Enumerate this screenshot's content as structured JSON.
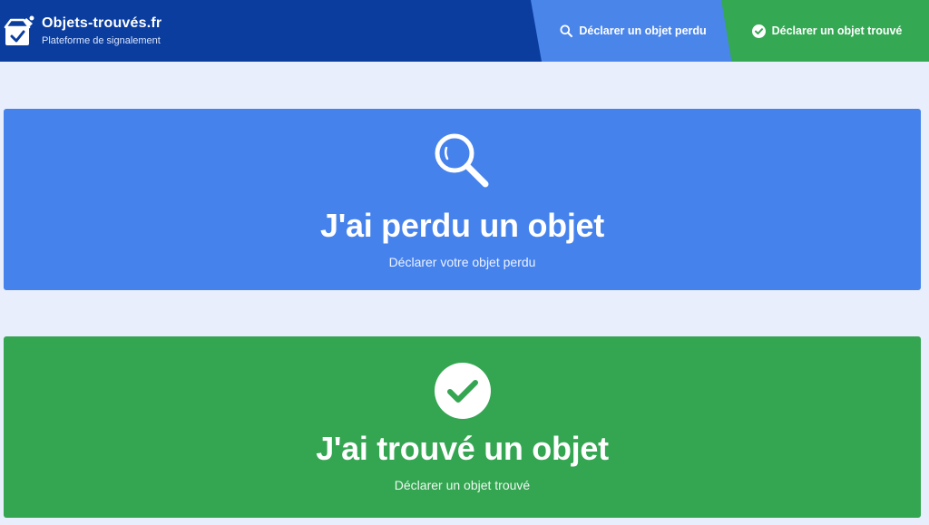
{
  "brand": {
    "title": "Objets-trouvés.fr",
    "subtitle": "Plateforme de signalement",
    "logo_icon": "box-check-icon"
  },
  "nav": {
    "lost_label": "Déclarer un objet perdu",
    "lost_icon": "search-icon",
    "found_label": "Déclarer un objet trouvé",
    "found_icon": "check-circle-icon"
  },
  "cards": {
    "lost": {
      "title": "J'ai perdu un objet",
      "subtitle": "Déclarer votre objet perdu",
      "icon": "magnifier-icon"
    },
    "found": {
      "title": "J'ai trouvé un objet",
      "subtitle": "Déclarer un objet trouvé",
      "icon": "check-circle-icon"
    }
  },
  "colors": {
    "header": "#0a3d9e",
    "page_background": "#e8eefb",
    "lost_blue": "#4582ec",
    "found_green": "#34a551"
  }
}
